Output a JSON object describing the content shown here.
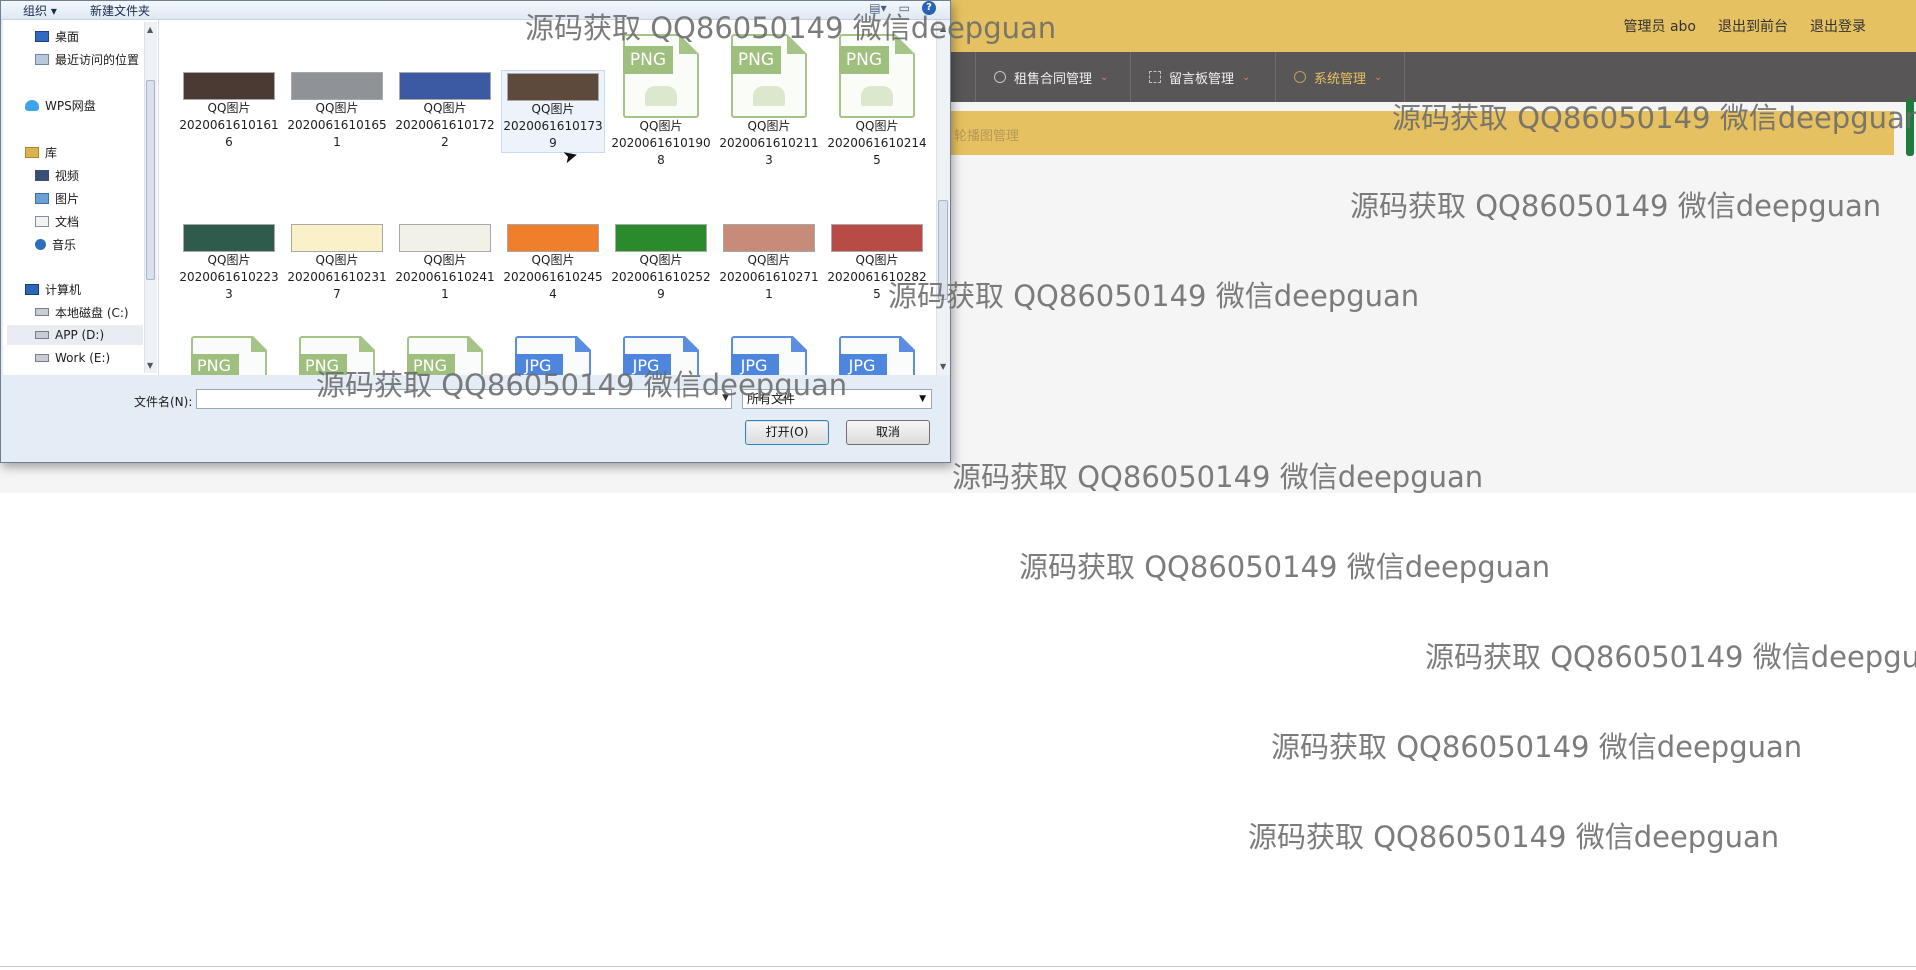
{
  "admin": {
    "header_links": [
      "管理员 abo",
      "退出到前台",
      "退出登录"
    ],
    "nav": [
      {
        "label": "租售合同管理",
        "active": false
      },
      {
        "label": "留言板管理",
        "active": false
      },
      {
        "label": "系统管理",
        "active": true
      }
    ],
    "breadcrumb": "轮播图管理",
    "colors": {
      "header": "#e6c161",
      "nav": "#585656",
      "active": "#e6c161"
    }
  },
  "dialog": {
    "toolbar": {
      "organize": "组织",
      "new_folder": "新建文件夹"
    },
    "nav_tree": [
      {
        "label": "桌面",
        "icon": "desktop-icon"
      },
      {
        "label": "最近访问的位置",
        "icon": "recent-places-icon"
      },
      {
        "label": "WPS网盘",
        "icon": "cloud-drive-icon"
      },
      {
        "label": "库",
        "icon": "library-icon"
      },
      {
        "label": "视频",
        "icon": "video-library-icon"
      },
      {
        "label": "图片",
        "icon": "pictures-library-icon"
      },
      {
        "label": "文档",
        "icon": "documents-library-icon"
      },
      {
        "label": "音乐",
        "icon": "music-library-icon"
      },
      {
        "label": "计算机",
        "icon": "computer-icon"
      },
      {
        "label": "本地磁盘 (C:)",
        "icon": "drive-icon"
      },
      {
        "label": "APP (D:)",
        "icon": "drive-icon"
      },
      {
        "label": "Work (E:)",
        "icon": "drive-icon"
      }
    ],
    "files_row1": [
      {
        "name": "QQ图片",
        "id": "20200616101616",
        "type": "thumb",
        "color": "#4a3a33"
      },
      {
        "name": "QQ图片",
        "id": "20200616101651",
        "type": "thumb",
        "color": "#8f9296"
      },
      {
        "name": "QQ图片",
        "id": "20200616101722",
        "type": "thumb",
        "color": "#3c5aa3"
      },
      {
        "name": "QQ图片",
        "id": "20200616101739",
        "type": "thumb",
        "color": "#5e4a3d"
      },
      {
        "name": "QQ图片",
        "id": "20200616101908",
        "type": "png"
      },
      {
        "name": "QQ图片",
        "id": "20200616102113",
        "type": "png"
      },
      {
        "name": "QQ图片",
        "id": "20200616102145",
        "type": "png"
      }
    ],
    "files_row2": [
      {
        "name": "QQ图片",
        "id": "20200616102233",
        "type": "thumb",
        "color": "#2f5b4c"
      },
      {
        "name": "QQ图片",
        "id": "20200616102317",
        "type": "thumb",
        "color": "#fbf1c8"
      },
      {
        "name": "QQ图片",
        "id": "20200616102411",
        "type": "thumb",
        "color": "#f1f1e8"
      },
      {
        "name": "QQ图片",
        "id": "20200616102454",
        "type": "thumb",
        "color": "#f07f2b"
      },
      {
        "name": "QQ图片",
        "id": "20200616102529",
        "type": "thumb",
        "color": "#2b8a2b"
      },
      {
        "name": "QQ图片",
        "id": "20200616102711",
        "type": "thumb",
        "color": "#c78b79"
      },
      {
        "name": "QQ图片",
        "id": "20200616102825",
        "type": "thumb",
        "color": "#b94b46"
      }
    ],
    "files_row3_types": [
      "PNG",
      "PNG",
      "PNG",
      "JPG",
      "JPG",
      "JPG",
      "JPG"
    ],
    "filename_label": "文件名(N):",
    "filename_value": "",
    "filetype_value": "所有文件",
    "open_label": "打开(O)",
    "cancel_label": "取消"
  },
  "watermark": "源码获取 QQ86050149 微信deepguan"
}
